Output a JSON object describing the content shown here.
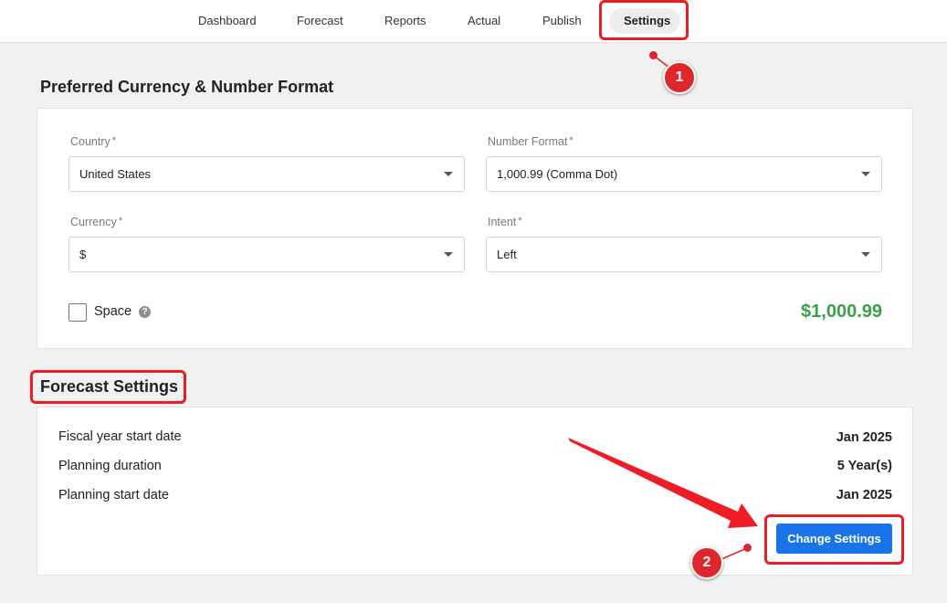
{
  "nav": {
    "tabs": [
      {
        "label": "Dashboard"
      },
      {
        "label": "Forecast"
      },
      {
        "label": "Reports"
      },
      {
        "label": "Actual"
      },
      {
        "label": "Publish"
      },
      {
        "label": "Settings",
        "active": true
      }
    ]
  },
  "currency_section": {
    "title": "Preferred Currency & Number Format",
    "country": {
      "label": "Country",
      "required_mark": "*",
      "value": "United States"
    },
    "number_format": {
      "label": "Number Format",
      "required_mark": "*",
      "value": "1,000.99 (Comma Dot)"
    },
    "currency": {
      "label": "Currency",
      "required_mark": "*",
      "value": "$"
    },
    "intent": {
      "label": "Intent",
      "required_mark": "*",
      "value": "Left"
    },
    "space": {
      "label": "Space",
      "checked": false,
      "help_icon": "question-circle-icon",
      "help_glyph": "?"
    },
    "preview": "$1,000.99"
  },
  "forecast_section": {
    "title": "Forecast Settings",
    "rows": [
      {
        "label": "Fiscal year start date",
        "value": "Jan 2025"
      },
      {
        "label": "Planning duration",
        "value": "5 Year(s)"
      },
      {
        "label": "Planning start date",
        "value": "Jan 2025"
      }
    ],
    "button_label": "Change Settings"
  },
  "annotations": {
    "step1": "1",
    "step2": "2",
    "highlight_color": "#ea1c24"
  },
  "colors": {
    "accent": "#1a73e8",
    "preview_green": "#3aa14a",
    "page_bg": "#f1f1f1"
  }
}
